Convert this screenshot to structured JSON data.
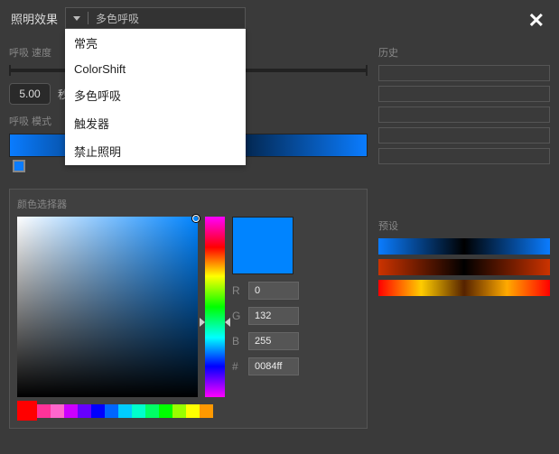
{
  "header": {
    "title": "照明效果",
    "close": "✕"
  },
  "dropdown": {
    "selected": "多色呼吸",
    "options": [
      "常亮",
      "ColorShift",
      "多色呼吸",
      "触发器",
      "禁止照明"
    ]
  },
  "speed": {
    "label": "呼吸 速度",
    "value": "5.00",
    "unit": "秒"
  },
  "mode": {
    "label": "呼吸 模式"
  },
  "picker": {
    "label": "颜色选择器",
    "r_label": "R",
    "g_label": "G",
    "b_label": "B",
    "hex_label": "#",
    "r": "0",
    "g": "132",
    "b": "255",
    "hex": "0084ff",
    "preview": "#0084ff",
    "swatches": [
      "#ff0000",
      "#ff3399",
      "#ff66cc",
      "#cc00ff",
      "#6600ff",
      "#0000ff",
      "#0066ff",
      "#00ccff",
      "#00ffcc",
      "#00ff66",
      "#00ff00",
      "#99ff00",
      "#ffff00",
      "#ff9900"
    ],
    "selected_swatch": 0
  },
  "history": {
    "label": "历史"
  },
  "presets": {
    "label": "预设"
  }
}
